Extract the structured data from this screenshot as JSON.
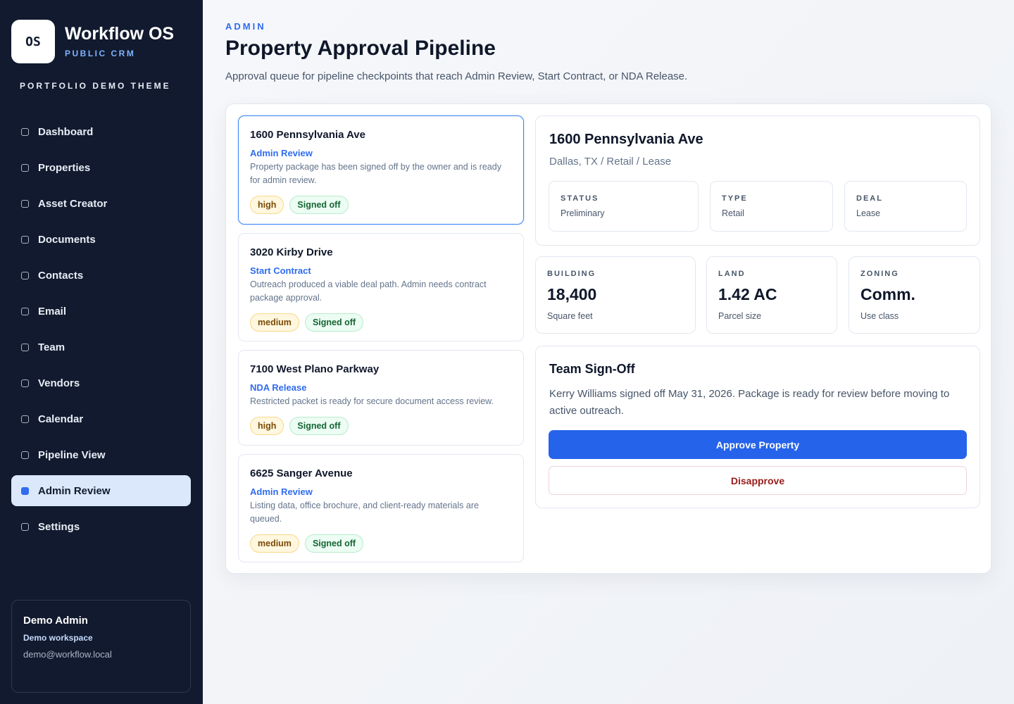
{
  "brand": {
    "logo": "OS",
    "name": "Workflow OS",
    "subtitle": "PUBLIC CRM",
    "theme": "PORTFOLIO DEMO THEME"
  },
  "nav": {
    "items": [
      {
        "label": "Dashboard"
      },
      {
        "label": "Properties"
      },
      {
        "label": "Asset Creator"
      },
      {
        "label": "Documents"
      },
      {
        "label": "Contacts"
      },
      {
        "label": "Email"
      },
      {
        "label": "Team"
      },
      {
        "label": "Vendors"
      },
      {
        "label": "Calendar"
      },
      {
        "label": "Pipeline View"
      },
      {
        "label": "Admin Review"
      },
      {
        "label": "Settings"
      }
    ],
    "active": "Admin Review"
  },
  "user": {
    "name": "Demo Admin",
    "workspace": "Demo workspace",
    "email": "demo@workflow.local"
  },
  "header": {
    "crumb": "ADMIN",
    "title": "Property Approval Pipeline",
    "description": "Approval queue for pipeline checkpoints that reach Admin Review, Start Contract, or NDA Release."
  },
  "queue": [
    {
      "title": "1600 Pennsylvania Ave",
      "stage": "Admin Review",
      "desc": "Property package has been signed off by the owner and is ready for admin review.",
      "priority": "high",
      "status": "Signed off"
    },
    {
      "title": "3020 Kirby Drive",
      "stage": "Start Contract",
      "desc": "Outreach produced a viable deal path. Admin needs contract package approval.",
      "priority": "medium",
      "status": "Signed off"
    },
    {
      "title": "7100 West Plano Parkway",
      "stage": "NDA Release",
      "desc": "Restricted packet is ready for secure document access review.",
      "priority": "high",
      "status": "Signed off"
    },
    {
      "title": "6625 Sanger Avenue",
      "stage": "Admin Review",
      "desc": "Listing data, office brochure, and client-ready materials are queued.",
      "priority": "medium",
      "status": "Signed off"
    }
  ],
  "detail": {
    "title": "1600 Pennsylvania Ave",
    "subtitle": "Dallas, TX / Retail / Lease",
    "status_label": "STATUS",
    "status_value": "Preliminary",
    "type_label": "TYPE",
    "type_value": "Retail",
    "deal_label": "DEAL",
    "deal_value": "Lease"
  },
  "metrics": {
    "building": {
      "label": "BUILDING",
      "value": "18,400",
      "caption": "Square feet"
    },
    "land": {
      "label": "LAND",
      "value": "1.42 AC",
      "caption": "Parcel size"
    },
    "zoning": {
      "label": "ZONING",
      "value": "Comm.",
      "caption": "Use class"
    }
  },
  "signoff": {
    "title": "Team Sign-Off",
    "text": "Kerry Williams signed off May 31, 2026. Package is ready for review before moving to active outreach.",
    "approve_label": "Approve Property",
    "disapprove_label": "Disapprove"
  },
  "colors": {
    "accent": "#2563eb",
    "sidebar": "#111a2e",
    "danger": "#991b1b"
  }
}
